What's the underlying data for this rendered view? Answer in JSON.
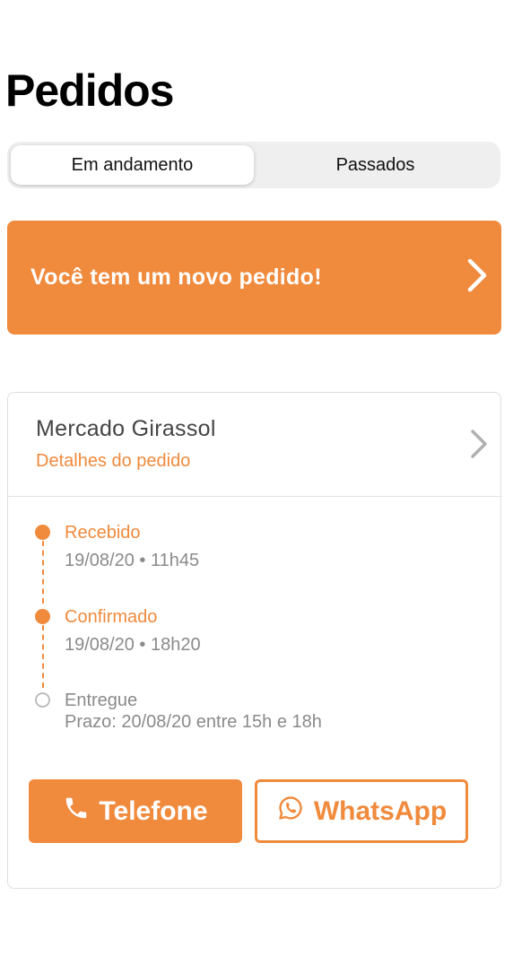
{
  "header": {
    "title": "Pedidos"
  },
  "tabs": [
    {
      "label": "Em andamento",
      "active": true
    },
    {
      "label": "Passados",
      "active": false
    }
  ],
  "banner": {
    "text": "Você tem um novo pedido!"
  },
  "order": {
    "store": "Mercado Girassol",
    "details_link": "Detalhes do pedido",
    "timeline": [
      {
        "label": "Recebido",
        "sub": "19/08/20 • 11h45",
        "done": true
      },
      {
        "label": "Confirmado",
        "sub": "19/08/20 • 18h20",
        "done": true
      },
      {
        "label": "Entregue",
        "sub": "Prazo: 20/08/20 entre 15h e 18h",
        "done": false
      }
    ],
    "actions": {
      "phone_label": "Telefone",
      "whatsapp_label": "WhatsApp"
    }
  },
  "colors": {
    "accent": "#f08a3c",
    "muted": "#8a8a8a"
  }
}
